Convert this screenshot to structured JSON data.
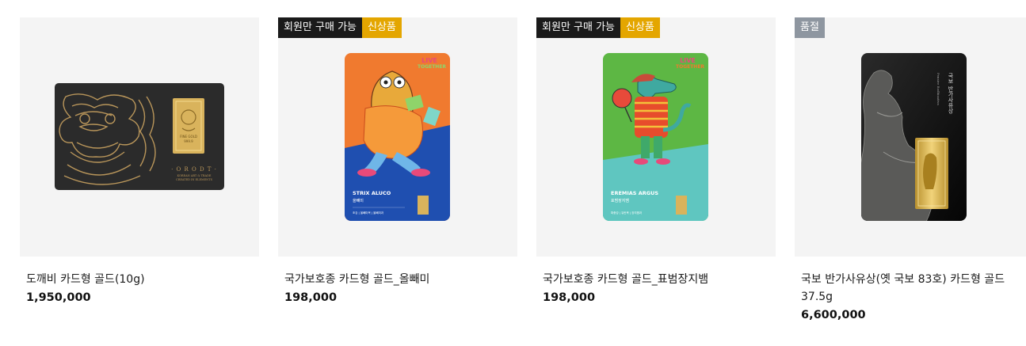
{
  "products": [
    {
      "name": "도깨비 카드형 골드(10g)",
      "price": "1,950,000",
      "badges": [],
      "image_text": [
        "· O R O D T ·",
        "KOREAN ART & TRADE",
        "CREATED IN ELEMENTS"
      ],
      "bar_text": [
        "도깨비",
        "FINE GOLD",
        "999.9"
      ]
    },
    {
      "name": "국가보호종 카드형 골드_올빼미",
      "price": "198,000",
      "badges": [
        "회원만 구매 가능",
        "신상품"
      ],
      "image_text": [
        "STRIX ALUCO",
        "올빼미",
        "조강 | 올빼미목 | 올빼미과"
      ],
      "logo_text": [
        "LIVE",
        "TOGETHER"
      ]
    },
    {
      "name": "국가보호종 카드형 골드_표범장지뱀",
      "price": "198,000",
      "badges": [
        "회원만 구매 가능",
        "신상품"
      ],
      "image_text": [
        "EREMIAS ARGUS",
        "표범장지뱀",
        "파충강 | 유린목 | 장지뱀과"
      ],
      "logo_text": [
        "LIVE",
        "TOGETHER"
      ]
    },
    {
      "name": "국보 반가사유상(옛 국보 83호) 카드형 골드 37.5g",
      "price": "6,600,000",
      "badges": [
        "품절"
      ],
      "image_text": [
        "국보 반가사유상",
        "Pensive Bodhisattva"
      ]
    }
  ],
  "colors": {
    "badge_dark": "#1a1a1a",
    "badge_gold": "#e4a600",
    "badge_soldout": "#8e96a0",
    "thumb_bg": "#f4f4f4",
    "owl_orange": "#f07a2f",
    "owl_blue": "#1f4fb0",
    "lizard_green": "#5db744",
    "lizard_teal": "#5fc6c0"
  }
}
